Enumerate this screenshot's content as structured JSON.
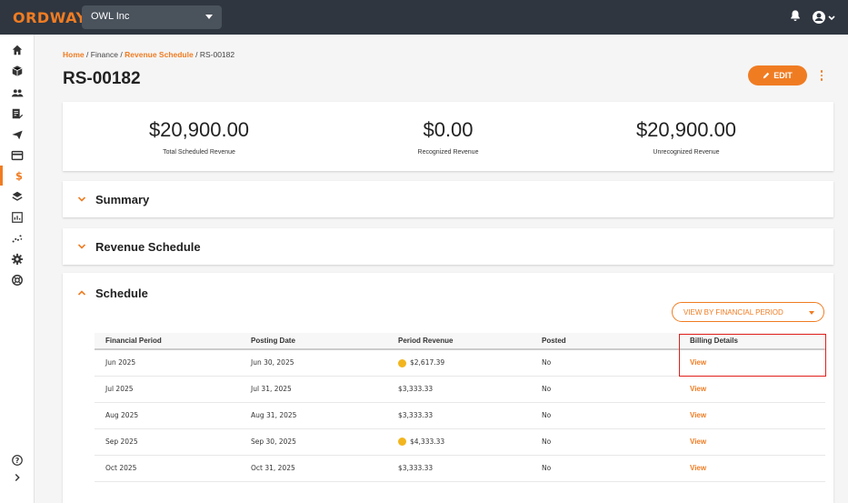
{
  "app": {
    "logo": "ORDWAY",
    "org": "OWL Inc"
  },
  "breadcrumb": {
    "home": "Home",
    "sep1": "/",
    "finance": "Finance",
    "sep2": "/",
    "revenue_schedule": "Revenue Schedule",
    "sep3": "/",
    "current": "RS-00182"
  },
  "page": {
    "title": "RS-00182",
    "edit_label": "EDIT"
  },
  "stats": [
    {
      "value": "$20,900.00",
      "label": "Total Scheduled Revenue"
    },
    {
      "value": "$0.00",
      "label": "Recognized Revenue"
    },
    {
      "value": "$20,900.00",
      "label": "Unrecognized Revenue"
    }
  ],
  "sections": {
    "summary": "Summary",
    "revenue_schedule": "Revenue Schedule",
    "schedule": "Schedule"
  },
  "schedule": {
    "view_select": "VIEW BY FINANCIAL PERIOD",
    "columns": [
      "Financial Period",
      "Posting Date",
      "Period Revenue",
      "Posted",
      "Billing Details"
    ],
    "rows": [
      {
        "period": "Jun 2025",
        "date": "Jun 30, 2025",
        "revenue": "$2,617.39",
        "coin": true,
        "posted": "No",
        "billing": "View"
      },
      {
        "period": "Jul 2025",
        "date": "Jul 31, 2025",
        "revenue": "$3,333.33",
        "coin": false,
        "posted": "No",
        "billing": "View"
      },
      {
        "period": "Aug 2025",
        "date": "Aug 31, 2025",
        "revenue": "$3,333.33",
        "coin": false,
        "posted": "No",
        "billing": "View"
      },
      {
        "period": "Sep 2025",
        "date": "Sep 30, 2025",
        "revenue": "$4,333.33",
        "coin": true,
        "posted": "No",
        "billing": "View"
      },
      {
        "period": "Oct 2025",
        "date": "Oct 31, 2025",
        "revenue": "$3,333.33",
        "coin": false,
        "posted": "No",
        "billing": "View"
      }
    ]
  },
  "colors": {
    "accent": "#f07c22",
    "topbar": "#2f3640",
    "highlight": "#e0201c"
  },
  "sidebar_icons": [
    "home-icon",
    "box-icon",
    "users-icon",
    "invoice-icon",
    "send-icon",
    "card-icon",
    "dollar-icon",
    "layers-icon",
    "report-icon",
    "scatter-icon",
    "settings-icon",
    "support-icon",
    "help-icon",
    "expand-icon"
  ]
}
